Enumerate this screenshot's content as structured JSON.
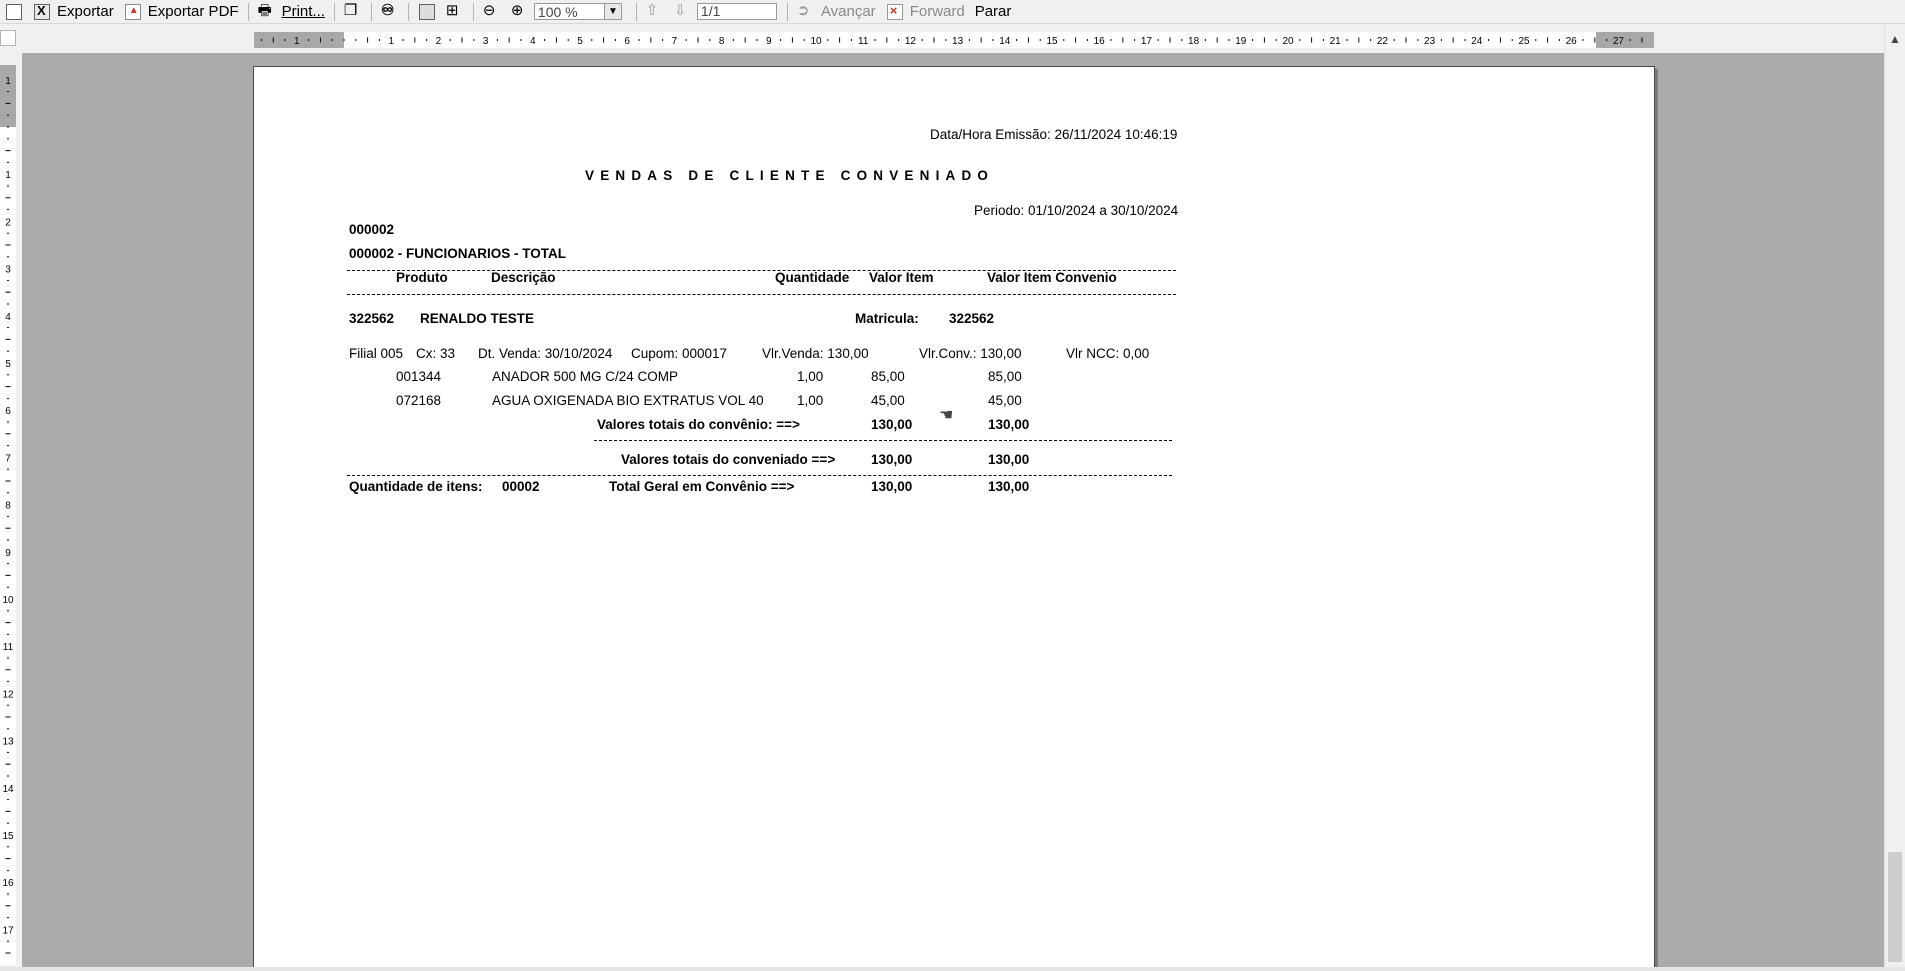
{
  "toolbar": {
    "export_label": "Exportar",
    "export_pdf_label": "Exportar PDF",
    "print_label": "Print...",
    "zoom_value": "100 %",
    "page_value": "1/1",
    "next_label": "Avançar",
    "forward_label": "Forward",
    "stop_label": "Parar"
  },
  "report": {
    "emission": "Data/Hora Emissão: 26/11/2024 10:46:19",
    "title": "VENDAS DE CLIENTE CONVENIADO",
    "period": "Periodo: 01/10/2024 a 30/10/2024",
    "group_code": "000002",
    "group_name": "000002 - FUNCIONARIOS - TOTAL",
    "headers": {
      "produto": "Produto",
      "descricao": "Descrição",
      "quantidade": "Quantidade",
      "valor_item": "Valor Item",
      "valor_item_convenio": "Valor Item Convenio"
    },
    "client": {
      "code": "322562",
      "name": "RENALDO TESTE",
      "matricula_label": "Matricula:",
      "matricula": "322562"
    },
    "sale": {
      "filial": "Filial 005",
      "cx": "Cx: 33",
      "dt_venda": "Dt. Venda: 30/10/2024",
      "cupom": "Cupom: 000017",
      "vlr_venda": "Vlr.Venda: 130,00",
      "vlr_conv": "Vlr.Conv.: 130,00",
      "vlr_ncc": "Vlr NCC: 0,00"
    },
    "items": [
      {
        "code": "001344",
        "description": "ANADOR 500 MG C/24 COMP",
        "qty": "1,00",
        "value": "85,00",
        "conv_value": "85,00"
      },
      {
        "code": "072168",
        "description": "AGUA OXIGENADA BIO EXTRATUS VOL 40",
        "qty": "1,00",
        "value": "45,00",
        "conv_value": "45,00"
      }
    ],
    "convenio_totals": {
      "label": "Valores totais do convênio:  ==>",
      "value": "130,00",
      "conv_value": "130,00"
    },
    "conveniado_totals": {
      "label": "Valores totais do conveniado  ==>",
      "value": "130,00",
      "conv_value": "130,00"
    },
    "qty_items_label": "Quantidade de itens:",
    "qty_items_value": "00002",
    "grand_total": {
      "label": "Total Geral em Convênio  ==>",
      "value": "130,00",
      "conv_value": "130,00"
    }
  }
}
